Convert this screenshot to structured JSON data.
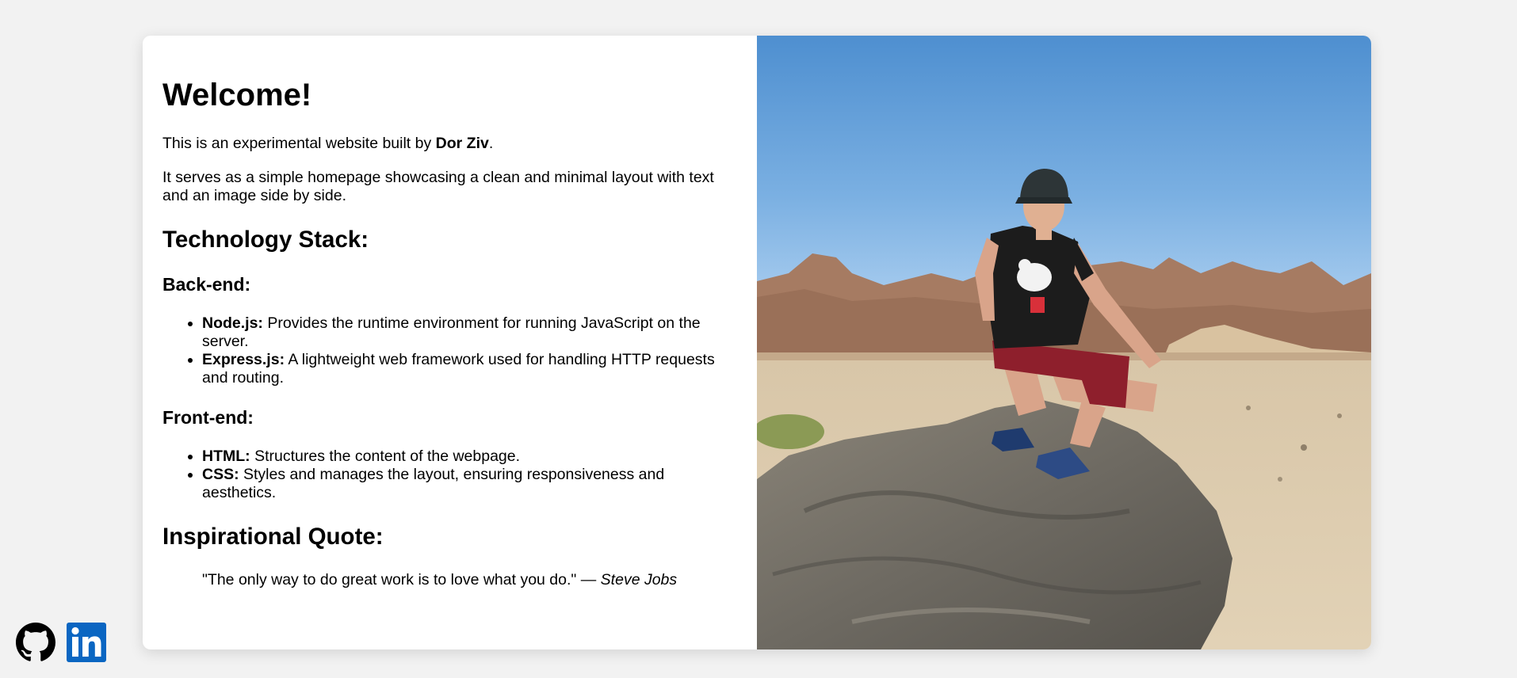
{
  "content": {
    "heading": "Welcome!",
    "intro_prefix": "This is an experimental website built by ",
    "intro_author": "Dor Ziv",
    "intro_suffix": ".",
    "description": "It serves as a simple homepage showcasing a clean and minimal layout with text and an image side by side.",
    "tech_heading": "Technology Stack:",
    "backend": {
      "heading": "Back-end:",
      "items": [
        {
          "name": "Node.js:",
          "desc": " Provides the runtime environment for running JavaScript on the server."
        },
        {
          "name": "Express.js:",
          "desc": " A lightweight web framework used for handling HTTP requests and routing."
        }
      ]
    },
    "frontend": {
      "heading": "Front-end:",
      "items": [
        {
          "name": "HTML:",
          "desc": " Structures the content of the webpage."
        },
        {
          "name": "CSS:",
          "desc": " Styles and manages the layout, ensuring responsiveness and aesthetics."
        }
      ]
    },
    "quote_heading": "Inspirational Quote:",
    "quote_text": "\"The only way to do great work is to love what you do.\" — ",
    "quote_author": "Steve Jobs"
  },
  "social": {
    "github_icon": "github-icon",
    "linkedin_icon": "linkedin-icon",
    "linkedin_color": "#0a66c2"
  },
  "colors": {
    "page_background": "#f2f2f2",
    "card_background": "#ffffff"
  }
}
